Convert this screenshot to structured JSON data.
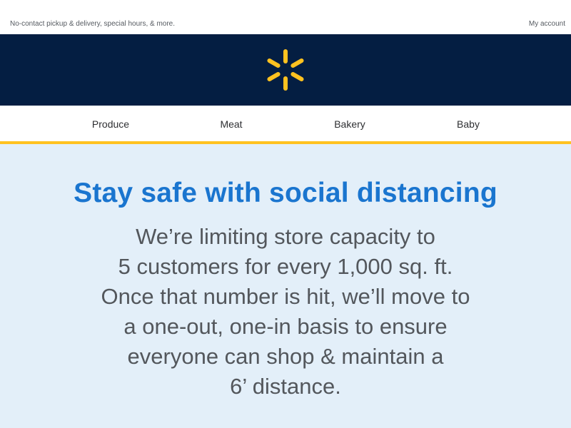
{
  "topbar": {
    "promo_text": "No-contact pickup & delivery, special hours, & more.",
    "account_link": "My account"
  },
  "brand": {
    "logo_icon": "spark-icon",
    "logo_color": "#ffc220",
    "background": "#041e42"
  },
  "nav": {
    "items": [
      {
        "label": "Produce"
      },
      {
        "label": "Meat"
      },
      {
        "label": "Bakery"
      },
      {
        "label": "Baby"
      }
    ],
    "accent_color": "#ffc220"
  },
  "hero": {
    "title": "Stay safe with social distancing",
    "title_color": "#1a75cf",
    "background": "#e3eff9",
    "lines": [
      "We’re limiting store capacity to",
      "5 customers for every 1,000 sq. ft.",
      "Once that number is hit, we’ll move to",
      "a one-out, one-in basis to ensure",
      "everyone can shop & maintain a",
      "6’ distance."
    ]
  }
}
